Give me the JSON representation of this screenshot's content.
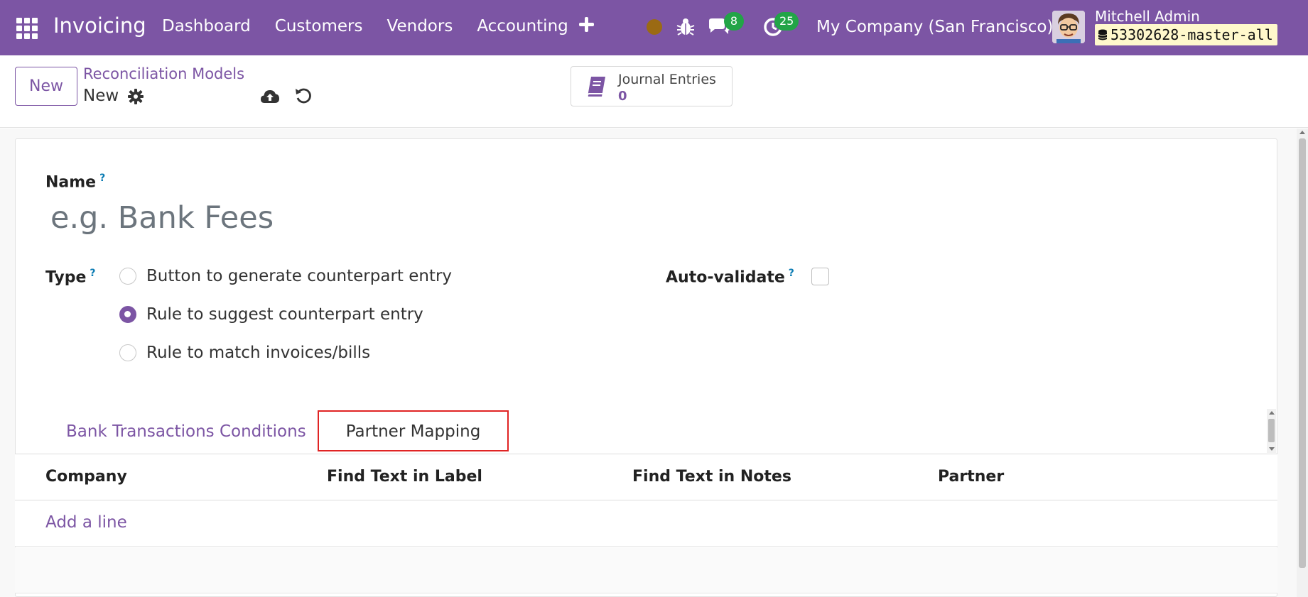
{
  "navbar": {
    "app_name": "Invoicing",
    "menu": [
      "Dashboard",
      "Customers",
      "Vendors",
      "Accounting"
    ],
    "messages_count": "8",
    "activities_count": "25",
    "company": "My Company (San Francisco)",
    "user_name": "Mitchell Admin",
    "database": "53302628-master-all",
    "status_dot_color": "#9b6a13",
    "icons": [
      "apps-grid-icon",
      "plus-icon",
      "bug-icon",
      "chat-icon",
      "clock-icon",
      "database-icon"
    ]
  },
  "control_panel": {
    "new_label": "New",
    "breadcrumb_parent": "Reconciliation Models",
    "breadcrumb_current": "New",
    "smart_button": {
      "title": "Journal Entries",
      "count": "0"
    }
  },
  "form": {
    "name_label": "Name",
    "name_placeholder": "e.g. Bank Fees",
    "name_value": "",
    "type_label": "Type",
    "type_options": [
      {
        "label": "Button to generate counterpart entry",
        "checked": false
      },
      {
        "label": "Rule to suggest counterpart entry",
        "checked": true
      },
      {
        "label": "Rule to match invoices/bills",
        "checked": false
      }
    ],
    "auto_validate_label": "Auto-validate",
    "auto_validate_checked": false,
    "help_mark": "?"
  },
  "tabs": [
    {
      "label": "Bank Transactions Conditions",
      "active": false
    },
    {
      "label": "Partner Mapping",
      "active": true
    }
  ],
  "table": {
    "columns": [
      "Company",
      "Find Text in Label",
      "Find Text in Notes",
      "Partner"
    ],
    "add_line_label": "Add a line"
  },
  "colors": {
    "brand": "#7c55a4",
    "badge": "#22a447",
    "highlight": "#e02424",
    "help": "#0a7bb3"
  }
}
